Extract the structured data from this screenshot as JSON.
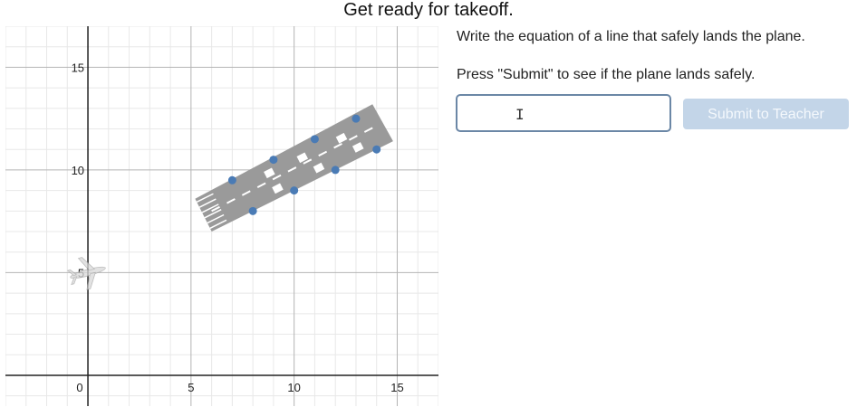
{
  "page": {
    "title": "Get ready for takeoff."
  },
  "instructions": {
    "line1": "Write the equation of a line that safely lands the plane.",
    "line2": "Press \"Submit\" to see if the plane lands safely."
  },
  "answer_input": {
    "value": "",
    "cursor_glyph": "I"
  },
  "submit_button": {
    "label": "Submit to Teacher",
    "enabled": false
  },
  "graph": {
    "x_range": [
      -4,
      17
    ],
    "y_range": [
      -1.5,
      17
    ],
    "x_ticks": [
      "0",
      "5",
      "10",
      "15"
    ],
    "y_ticks": [
      "5",
      "10",
      "15"
    ],
    "grid_minor": true,
    "runway": {
      "corners": [
        [
          6,
          7
        ],
        [
          5.2,
          8.6
        ],
        [
          13.8,
          13.2
        ],
        [
          14.8,
          11.4
        ]
      ],
      "points": [
        {
          "x": 7,
          "y": 9.5
        },
        {
          "x": 9,
          "y": 10.5
        },
        {
          "x": 11,
          "y": 11.5
        },
        {
          "x": 13,
          "y": 12.5
        },
        {
          "x": 8,
          "y": 8
        },
        {
          "x": 10,
          "y": 9
        },
        {
          "x": 12,
          "y": 10
        },
        {
          "x": 14,
          "y": 11
        }
      ]
    },
    "plane_position": {
      "x": 0,
      "y": 5
    },
    "colors": {
      "runway": "#9a9a9a",
      "point": "#4a7bb5",
      "grid_minor": "#e8e8e8",
      "grid_major": "#b4b4b4",
      "axis": "#222222"
    }
  }
}
